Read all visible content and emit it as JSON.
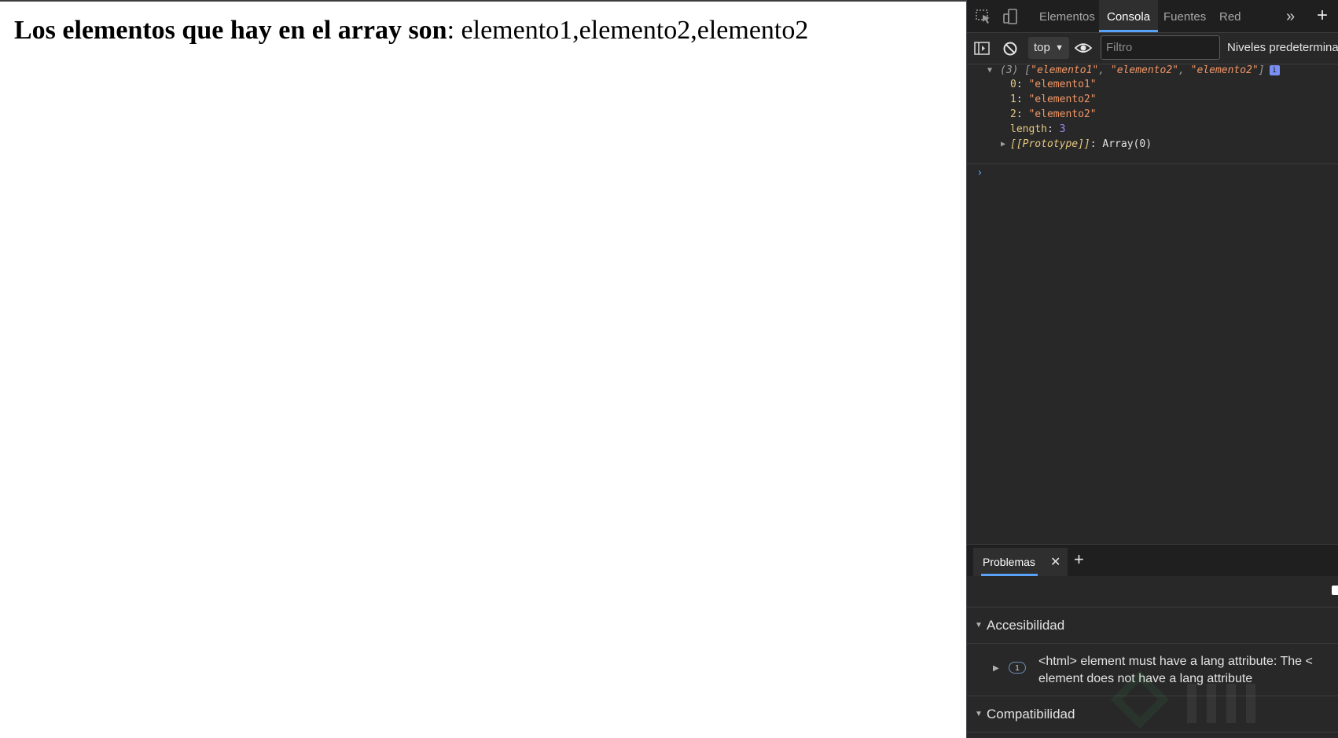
{
  "page": {
    "heading_bold": "Los elementos que hay en el array son",
    "heading_rest": ": elemento1,elemento2,elemento2"
  },
  "devtools": {
    "tabs": [
      {
        "label": "Elementos",
        "active": false
      },
      {
        "label": "Consola",
        "active": true
      },
      {
        "label": "Fuentes",
        "active": false
      },
      {
        "label": "Red",
        "active": false
      }
    ],
    "toolbar": {
      "context": "top",
      "filter_placeholder": "Filtro",
      "levels_label": "Niveles predetermina"
    },
    "console_log": {
      "summary_count": "(3)",
      "summary_open": " [",
      "summary_items": [
        "\"elemento1\"",
        "\"elemento2\"",
        "\"elemento2\""
      ],
      "summary_close": "]",
      "info_badge": "i",
      "entries": [
        {
          "key": "0",
          "value": "\"elemento1\""
        },
        {
          "key": "1",
          "value": "\"elemento2\""
        },
        {
          "key": "2",
          "value": "\"elemento2\""
        }
      ],
      "length_key": "length",
      "length_value": "3",
      "prototype_key": "[[Prototype]]",
      "prototype_value": "Array(0)",
      "prompt": "›"
    },
    "drawer": {
      "tab_label": "Problemas",
      "tab_close": "✕",
      "add_tab": "+"
    },
    "issues": {
      "sections": [
        {
          "title": "Accesibilidad"
        },
        {
          "title": "Compatibilidad"
        }
      ],
      "accessibility_issue": {
        "count": "1",
        "text": "<html> element must have a lang attribute: The <\nelement does not have a lang attribute"
      }
    }
  },
  "colors": {
    "devtools_bg": "#282828",
    "tab_active_underline": "#5aa2f7",
    "string_value": "#f29766",
    "number_value": "#9b8cf5"
  },
  "icons": [
    "inspect-element-icon",
    "device-toolbar-icon",
    "more-tabs-icon",
    "add-tab-icon",
    "sidebar-toggle-icon",
    "clear-console-icon",
    "live-expression-eye-icon"
  ]
}
